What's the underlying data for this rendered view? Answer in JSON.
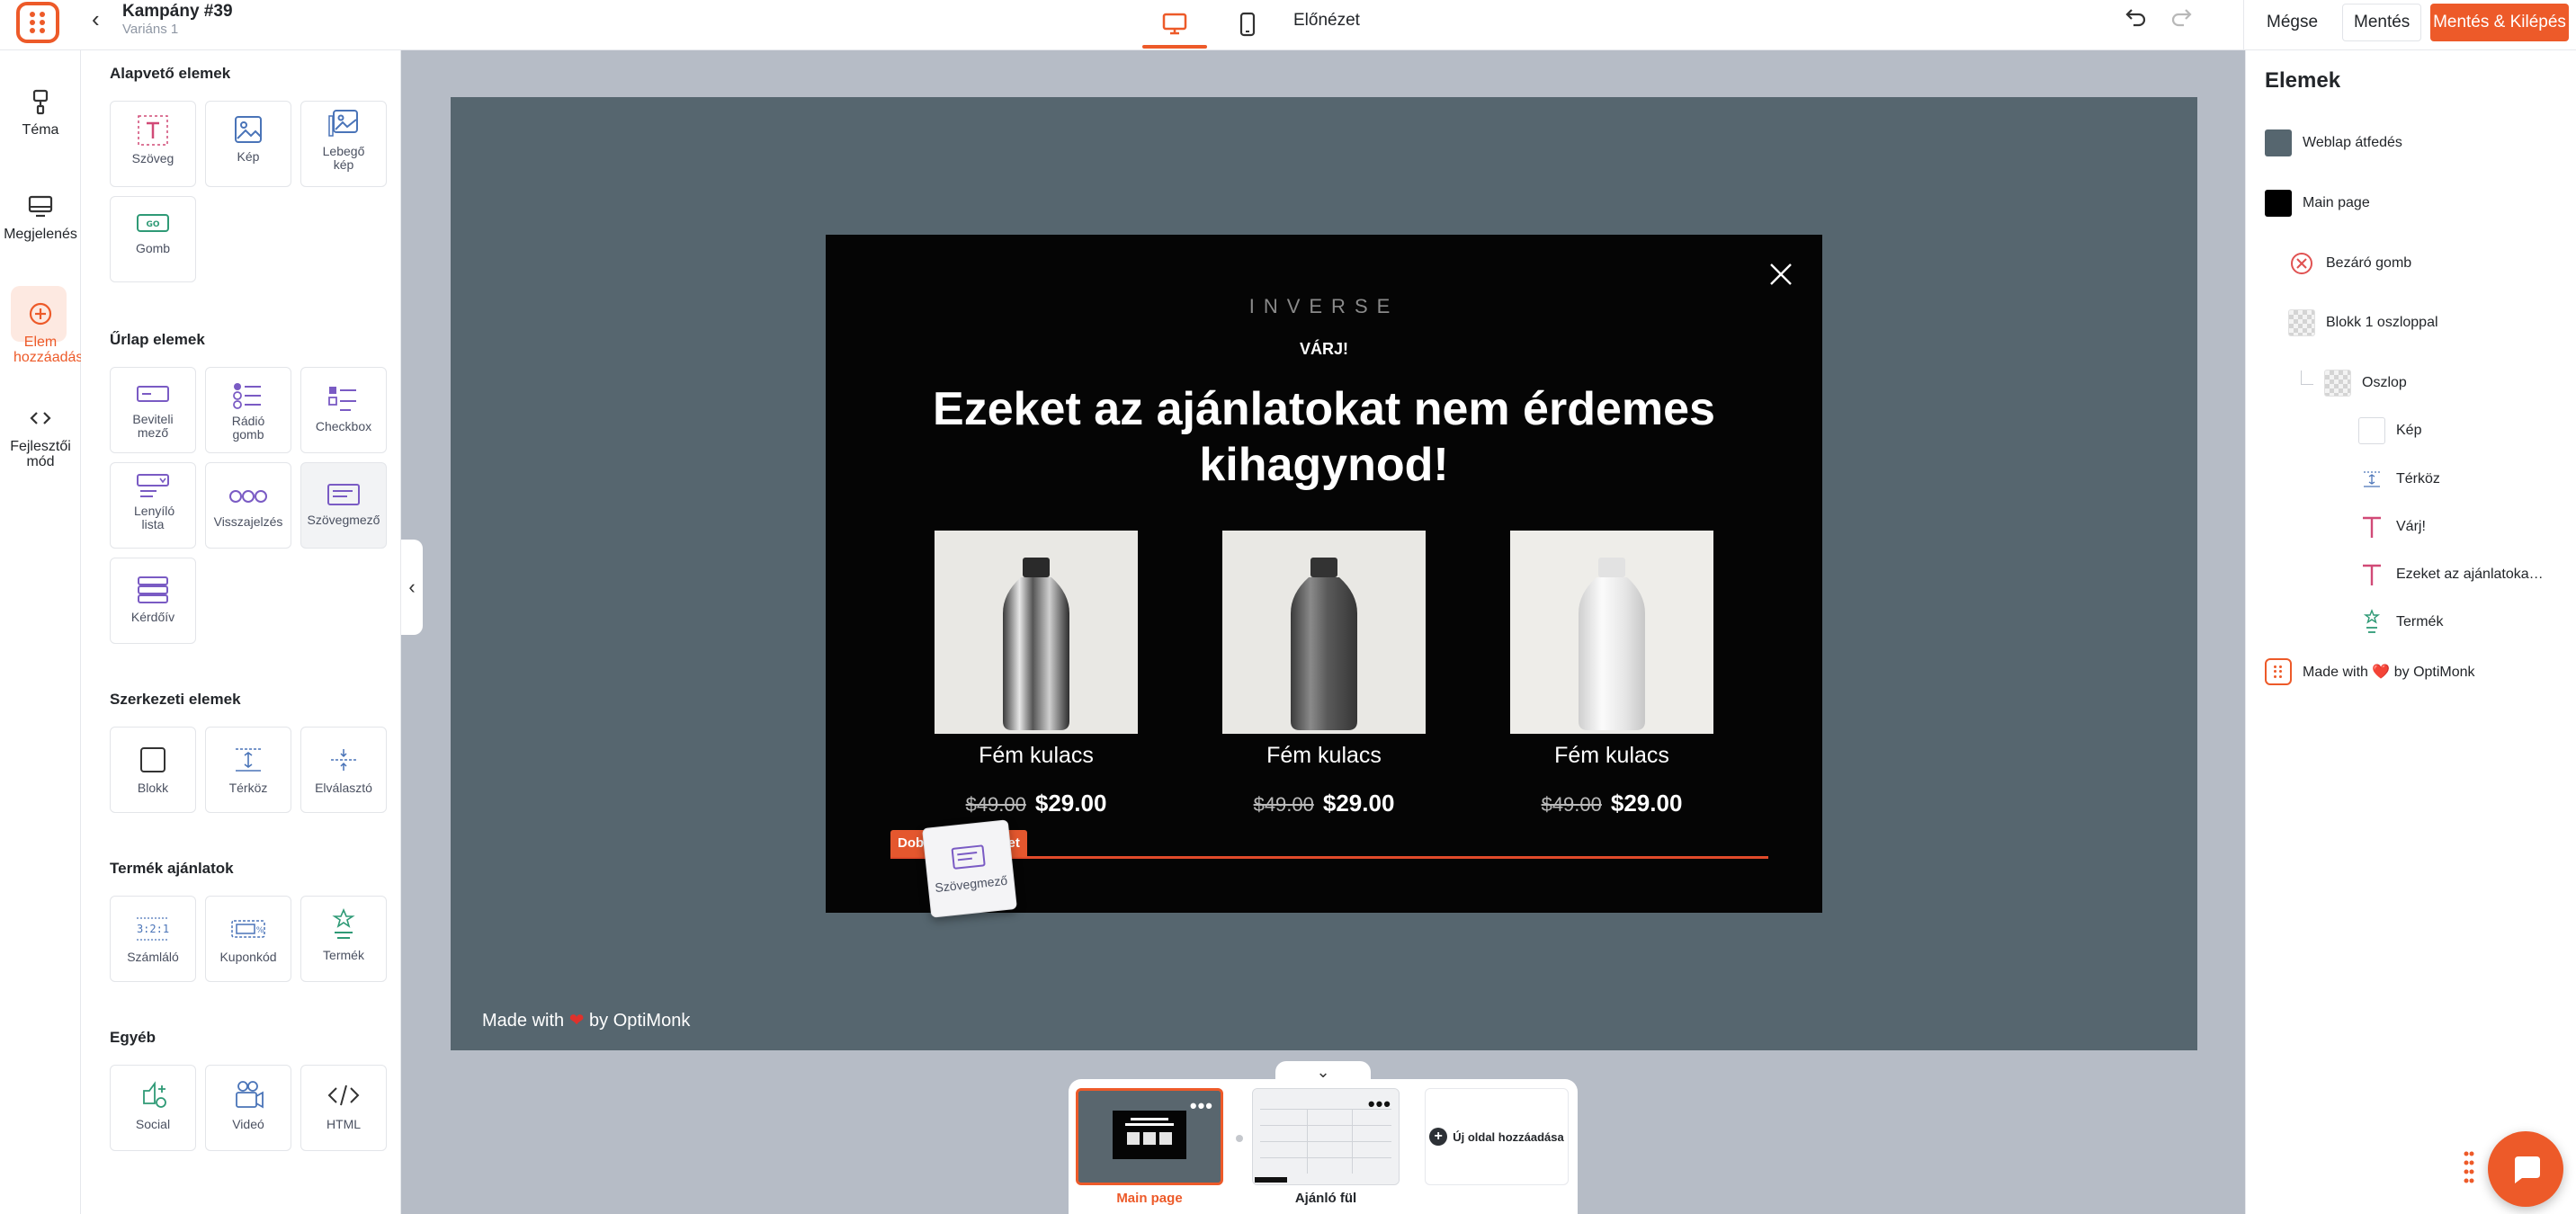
{
  "header": {
    "campaign_title": "Kampány #39",
    "variant": "Variáns 1",
    "preview_label": "Előnézet",
    "cancel_label": "Mégse",
    "save_label": "Mentés",
    "save_exit_label": "Mentés & Kilépés"
  },
  "rail": {
    "items": [
      {
        "label": "Téma",
        "icon": "brush-icon"
      },
      {
        "label": "Megjelenés",
        "icon": "monitor-icon"
      },
      {
        "label": "Elem hozzáadás",
        "icon": "plus-circle-icon",
        "active": true
      },
      {
        "label": "Fejlesztői mód",
        "icon": "code-icon"
      }
    ]
  },
  "panel": {
    "sections": [
      {
        "title": "Alapvető elemek",
        "items": [
          "Szöveg",
          "Kép",
          "Lebegő kép",
          "Gomb"
        ]
      },
      {
        "title": "Űrlap elemek",
        "items": [
          "Beviteli mező",
          "Rádió gomb",
          "Checkbox",
          "Lenyíló lista",
          "Visszajelzés",
          "Szövegmező",
          "Kérdőív"
        ]
      },
      {
        "title": "Szerkezeti elemek",
        "items": [
          "Blokk",
          "Térköz",
          "Elválasztó"
        ]
      },
      {
        "title": "Termék ajánlatok",
        "items": [
          "Számláló",
          "Kuponkód",
          "Termék"
        ]
      },
      {
        "title": "Egyéb",
        "items": [
          "Social",
          "Videó",
          "HTML"
        ]
      }
    ],
    "gomb_badge": "GO",
    "counter_badge": "3:2:1"
  },
  "popup": {
    "brand": "INVERSE",
    "eyebrow": "VÁRJ!",
    "headline_line1": "Ezeket az ajánlatokat nem érdemes",
    "headline_line2": "kihagynod!",
    "products": [
      {
        "name": "Fém kulacs",
        "old_price": "$49.00",
        "new_price": "$29.00",
        "color": "chrome"
      },
      {
        "name": "Fém kulacs",
        "old_price": "$49.00",
        "new_price": "$29.00",
        "color": "graphite"
      },
      {
        "name": "Fém kulacs",
        "old_price": "$49.00",
        "new_price": "$29.00",
        "color": "white"
      }
    ],
    "drop_label": "Dobd ide az elemet",
    "drag_item_label": "Szövegmező"
  },
  "canvas": {
    "made_with_prefix": "Made with",
    "made_with_suffix": "by OptiMonk",
    "heart": "❤"
  },
  "pages": {
    "items": [
      {
        "label": "Main page",
        "active": true
      },
      {
        "label": "Ajánló fül",
        "active": false
      }
    ],
    "add_label": "Új oldal hozzáadása",
    "toggle": "⌄"
  },
  "layers": {
    "title": "Elemek",
    "items": [
      {
        "label": "Weblap átfedés",
        "kind": "swatch",
        "color": "#56666f"
      },
      {
        "label": "Main page",
        "kind": "swatch",
        "color": "#000000"
      },
      {
        "label": "Bezáró gomb",
        "kind": "close"
      },
      {
        "label": "Blokk 1 oszloppal",
        "kind": "checker"
      },
      {
        "label": "Oszlop",
        "kind": "checker"
      },
      {
        "label": "Kép",
        "kind": "blank"
      },
      {
        "label": "Térköz",
        "kind": "spacer"
      },
      {
        "label": "Várj!",
        "kind": "text"
      },
      {
        "label": "Ezeket az ajánlatoka…",
        "kind": "text"
      },
      {
        "label": "Termék",
        "kind": "product"
      },
      {
        "label": "Made with ❤️ by OptiMonk",
        "kind": "logo"
      }
    ]
  },
  "colors": {
    "accent": "#ed5a29",
    "canvas_bg": "#b6bcc6",
    "site_bg": "#56666f",
    "popup_bg": "#050505"
  }
}
